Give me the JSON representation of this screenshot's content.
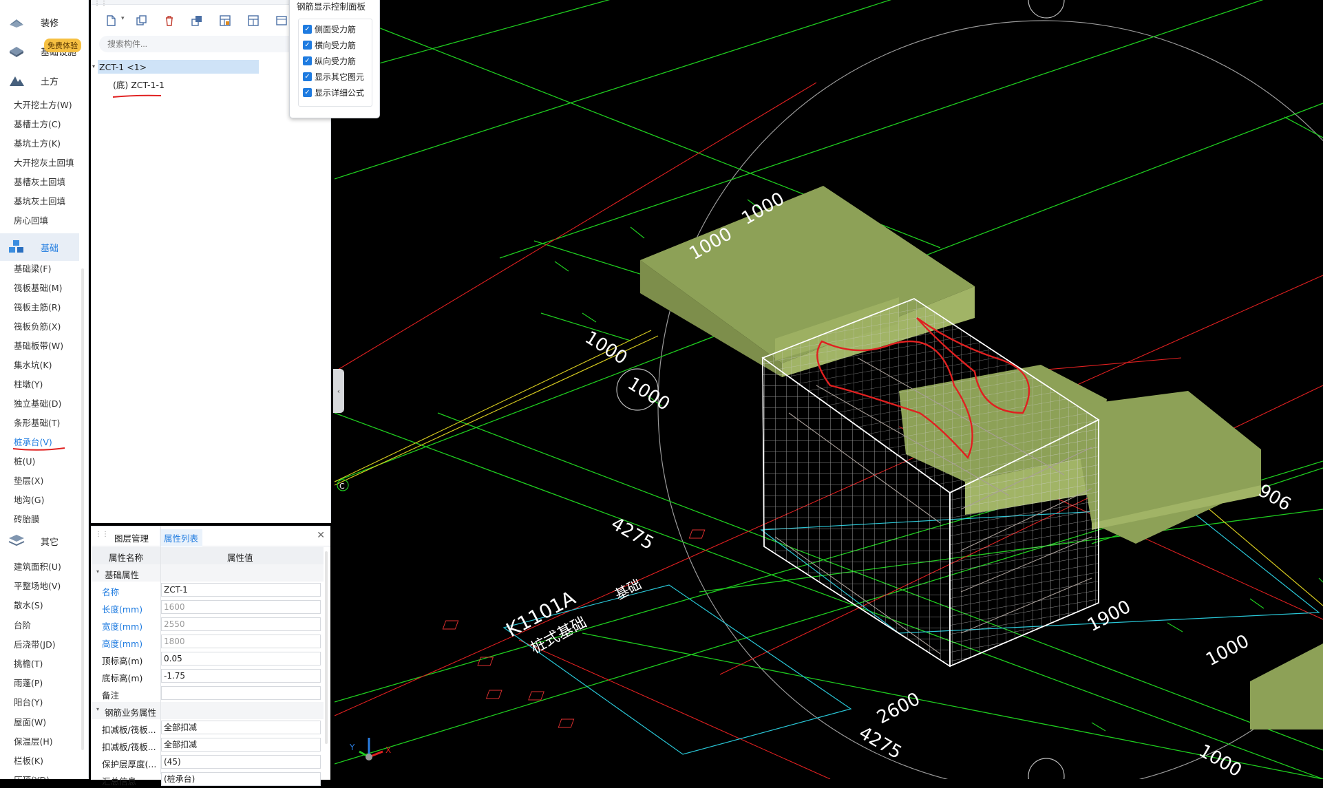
{
  "nav": {
    "badge": "免费体验",
    "groups": [
      {
        "label": "装修",
        "icon": "decoration-icon"
      },
      {
        "label": "基础设施",
        "icon": "infrastructure-icon"
      },
      {
        "label": "土方",
        "icon": "earthwork-icon"
      },
      {
        "label": "基础",
        "icon": "foundation-icon"
      },
      {
        "label": "其它",
        "icon": "other-icon"
      }
    ],
    "earthwork_items": [
      "大开挖土方(W)",
      "基槽土方(C)",
      "基坑土方(K)",
      "大开挖灰土回填",
      "基槽灰土回填",
      "基坑灰土回填",
      "房心回填"
    ],
    "foundation_items": [
      "基础梁(F)",
      "筏板基础(M)",
      "筏板主筋(R)",
      "筏板负筋(X)",
      "基础板带(W)",
      "集水坑(K)",
      "柱墩(Y)",
      "独立基础(D)",
      "条形基础(T)",
      "桩承台(V)",
      "桩(U)",
      "垫层(X)",
      "地沟(G)",
      "砖胎膜"
    ],
    "other_items": [
      "建筑面积(U)",
      "平整场地(V)",
      "散水(S)",
      "台阶",
      "后浇带(JD)",
      "挑檐(T)",
      "雨蓬(P)",
      "阳台(Y)",
      "屋面(W)",
      "保温层(H)",
      "栏板(K)",
      "压顶(YD)"
    ],
    "active_item": "桩承台(V)"
  },
  "tree": {
    "search_placeholder": "搜索构件...",
    "root": "ZCT-1 <1>",
    "child": "(底) ZCT-1-1"
  },
  "props": {
    "tab_layers": "图层管理",
    "tab_props": "属性列表",
    "col_name": "属性名称",
    "col_value": "属性值",
    "group_basic": "基础属性",
    "rows": [
      {
        "name": "名称",
        "value": "ZCT-1"
      },
      {
        "name": "长度(mm)",
        "value": "1600"
      },
      {
        "name": "宽度(mm)",
        "value": "2550"
      },
      {
        "name": "高度(mm)",
        "value": "1800"
      },
      {
        "name": "顶标高(m)",
        "value": "0.05"
      },
      {
        "name": "底标高(m)",
        "value": "-1.75"
      },
      {
        "name": "备注",
        "value": ""
      }
    ],
    "group_rebar": "钢筋业务属性",
    "rebar_rows": [
      {
        "name": "扣减板/筏板...",
        "value": "全部扣减"
      },
      {
        "name": "扣减板/筏板...",
        "value": "全部扣减"
      },
      {
        "name": "保护层厚度(...",
        "value": "(45)"
      },
      {
        "name": "汇总信息",
        "value": "(桩承台)"
      }
    ]
  },
  "rebar_panel": {
    "title": "钢筋显示控制面板",
    "options": [
      "侧面受力筋",
      "横向受力筋",
      "纵向受力筋",
      "显示其它图元",
      "显示详细公式"
    ]
  },
  "viewport": {
    "dims": [
      "1000",
      "1000",
      "1000",
      "1000",
      "1900",
      "1000",
      "2600",
      "4275",
      "4275",
      "906",
      "1000"
    ],
    "axis_c": "C",
    "text_block": "K1101A",
    "text_block2": "桩式基础",
    "text_block3": "基础",
    "axis_x": "X",
    "axis_y": "Y",
    "colors": {
      "slab": "#8da157",
      "wire": "#ffffff",
      "grid_green": "#1fcc1f",
      "grid_yellow": "#d4c81f",
      "cyan": "#29c6d6",
      "red": "#e02020"
    }
  }
}
